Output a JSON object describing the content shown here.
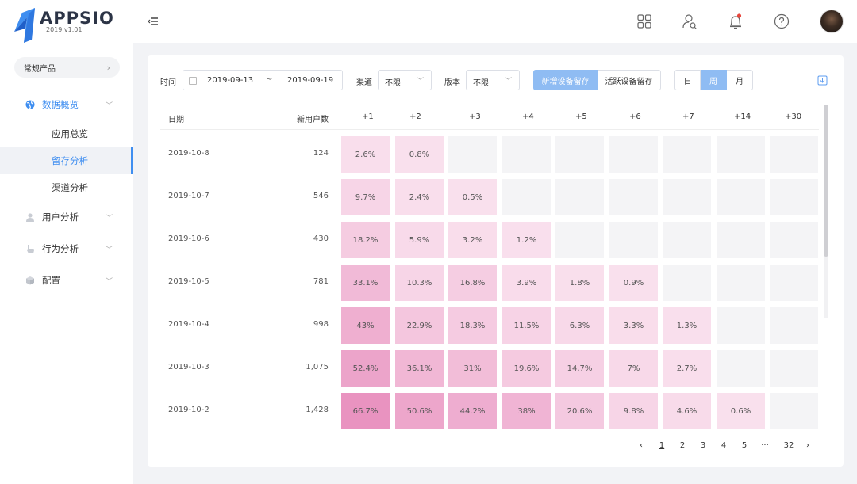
{
  "brand": {
    "name": "APPSIO",
    "version": "2019 v1.01"
  },
  "product_selector": {
    "label": "常规产品"
  },
  "sidebar": {
    "groups": [
      {
        "label": "数据概览",
        "icon": "globe-icon",
        "expanded": true,
        "children": [
          {
            "label": "应用总览"
          },
          {
            "label": "留存分析",
            "active": true
          },
          {
            "label": "渠道分析"
          }
        ]
      },
      {
        "label": "用户分析",
        "icon": "user-icon"
      },
      {
        "label": "行为分析",
        "icon": "pointer-icon"
      },
      {
        "label": "配置",
        "icon": "cube-icon"
      }
    ]
  },
  "topbar": {
    "icons": [
      "apps-grid-icon",
      "user-search-icon",
      "bell-icon",
      "help-icon"
    ],
    "notification_dot": true
  },
  "filters": {
    "time_label": "时间",
    "date_start": "2019-09-13",
    "date_sep": "~",
    "date_end": "2019-09-19",
    "channel_label": "渠道",
    "channel_value": "不限",
    "version_label": "版本",
    "version_value": "不限",
    "retention_types": [
      {
        "label": "新增设备留存",
        "active": true
      },
      {
        "label": "活跃设备留存",
        "active": false
      }
    ],
    "granularity": [
      {
        "label": "日",
        "active": false
      },
      {
        "label": "周",
        "active": true
      },
      {
        "label": "月",
        "active": false
      }
    ]
  },
  "table": {
    "headers": [
      "日期",
      "新用户数",
      "+1",
      "+2",
      "+3",
      "+4",
      "+5",
      "+6",
      "+7",
      "+14",
      "+30"
    ],
    "rows": [
      {
        "date": "2019-10-8",
        "new_users": "124",
        "cells": [
          "2.6%",
          "0.8%",
          "",
          "",
          "",
          "",
          "",
          "",
          ""
        ],
        "levels": [
          2.6,
          0.8,
          null,
          null,
          null,
          null,
          null,
          null,
          null
        ]
      },
      {
        "date": "2019-10-7",
        "new_users": "546",
        "cells": [
          "9.7%",
          "2.4%",
          "0.5%",
          "",
          "",
          "",
          "",
          "",
          ""
        ],
        "levels": [
          9.7,
          2.4,
          0.5,
          null,
          null,
          null,
          null,
          null,
          null
        ]
      },
      {
        "date": "2019-10-6",
        "new_users": "430",
        "cells": [
          "18.2%",
          "5.9%",
          "3.2%",
          "1.2%",
          "",
          "",
          "",
          "",
          ""
        ],
        "levels": [
          18.2,
          5.9,
          3.2,
          1.2,
          null,
          null,
          null,
          null,
          null
        ]
      },
      {
        "date": "2019-10-5",
        "new_users": "781",
        "cells": [
          "33.1%",
          "10.3%",
          "16.8%",
          "3.9%",
          "1.8%",
          "0.9%",
          "",
          "",
          ""
        ],
        "levels": [
          33.1,
          10.3,
          16.8,
          3.9,
          1.8,
          0.9,
          null,
          null,
          null
        ]
      },
      {
        "date": "2019-10-4",
        "new_users": "998",
        "cells": [
          "43%",
          "22.9%",
          "18.3%",
          "11.5%",
          "6.3%",
          "3.3%",
          "1.3%",
          "",
          ""
        ],
        "levels": [
          43,
          22.9,
          18.3,
          11.5,
          6.3,
          3.3,
          1.3,
          null,
          null
        ]
      },
      {
        "date": "2019-10-3",
        "new_users": "1,075",
        "cells": [
          "52.4%",
          "36.1%",
          "31%",
          "19.6%",
          "14.7%",
          "7%",
          "2.7%",
          "",
          ""
        ],
        "levels": [
          52.4,
          36.1,
          31,
          19.6,
          14.7,
          7,
          2.7,
          null,
          null
        ]
      },
      {
        "date": "2019-10-2",
        "new_users": "1,428",
        "cells": [
          "66.7%",
          "50.6%",
          "44.2%",
          "38%",
          "20.6%",
          "9.8%",
          "4.6%",
          "0.6%",
          ""
        ],
        "levels": [
          66.7,
          50.6,
          44.2,
          38,
          20.6,
          9.8,
          4.6,
          0.6,
          null
        ]
      }
    ],
    "heat_color": "#e88fbe",
    "empty_color": "#f4f4f6"
  },
  "pagination": {
    "prev": "‹",
    "pages": [
      "1",
      "2",
      "3",
      "4",
      "5"
    ],
    "ellipsis": "···",
    "last": "32",
    "next": "›",
    "current": "1"
  },
  "colors": {
    "accent": "#3f8ef0",
    "accent_light": "#8fbcf3",
    "bell_dot": "#e8453c"
  }
}
